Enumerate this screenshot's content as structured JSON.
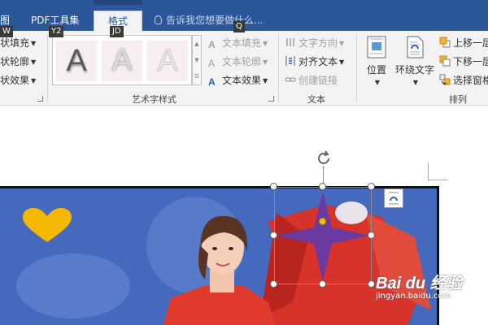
{
  "tabs": {
    "pdf": "PDF工具集",
    "format": "格式",
    "partial_left": "图",
    "tell_me": "告诉我您想要做什么..."
  },
  "keytips": {
    "w": "W",
    "y2": "Y2",
    "jd": "JD",
    "q": "Q"
  },
  "shape_styles": {
    "fill": "状填充",
    "outline": "状轮廓",
    "effect": "状效果"
  },
  "wordart": {
    "group_label": "艺术字样式",
    "letter": "A",
    "text_fill": "文本填充",
    "text_outline": "文本轮廓",
    "text_effect": "文本效果"
  },
  "text_group": {
    "group_label": "文本",
    "direction": "文字方向",
    "align": "对齐文本",
    "link": "创建链接"
  },
  "arrange": {
    "group_label": "排列",
    "position": "位置",
    "wrap": "环绕文字",
    "forward": "上移一层",
    "backward": "下移一层",
    "selection_pane": "选择窗格"
  },
  "watermark": {
    "logo": "Bai du 经验",
    "url": "jingyan.baidu.com"
  },
  "colors": {
    "ribbon_blue": "#2b579a",
    "star": "#6a3aa0",
    "heart": "#f5b800",
    "dress": "#e03a2c"
  }
}
